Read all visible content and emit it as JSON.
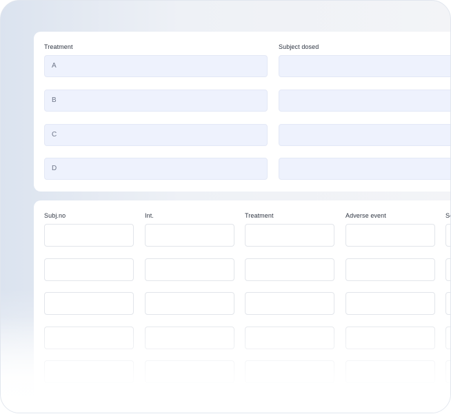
{
  "treatment_panel": {
    "treatment_header": "Treatment",
    "subject_dosed_header": "Subject dosed",
    "treatments": [
      "A",
      "B",
      "C",
      "D"
    ]
  },
  "ae_table": {
    "columns": [
      "Subj.no",
      "Int.",
      "Treatment",
      "Adverse event",
      "Se"
    ]
  }
}
